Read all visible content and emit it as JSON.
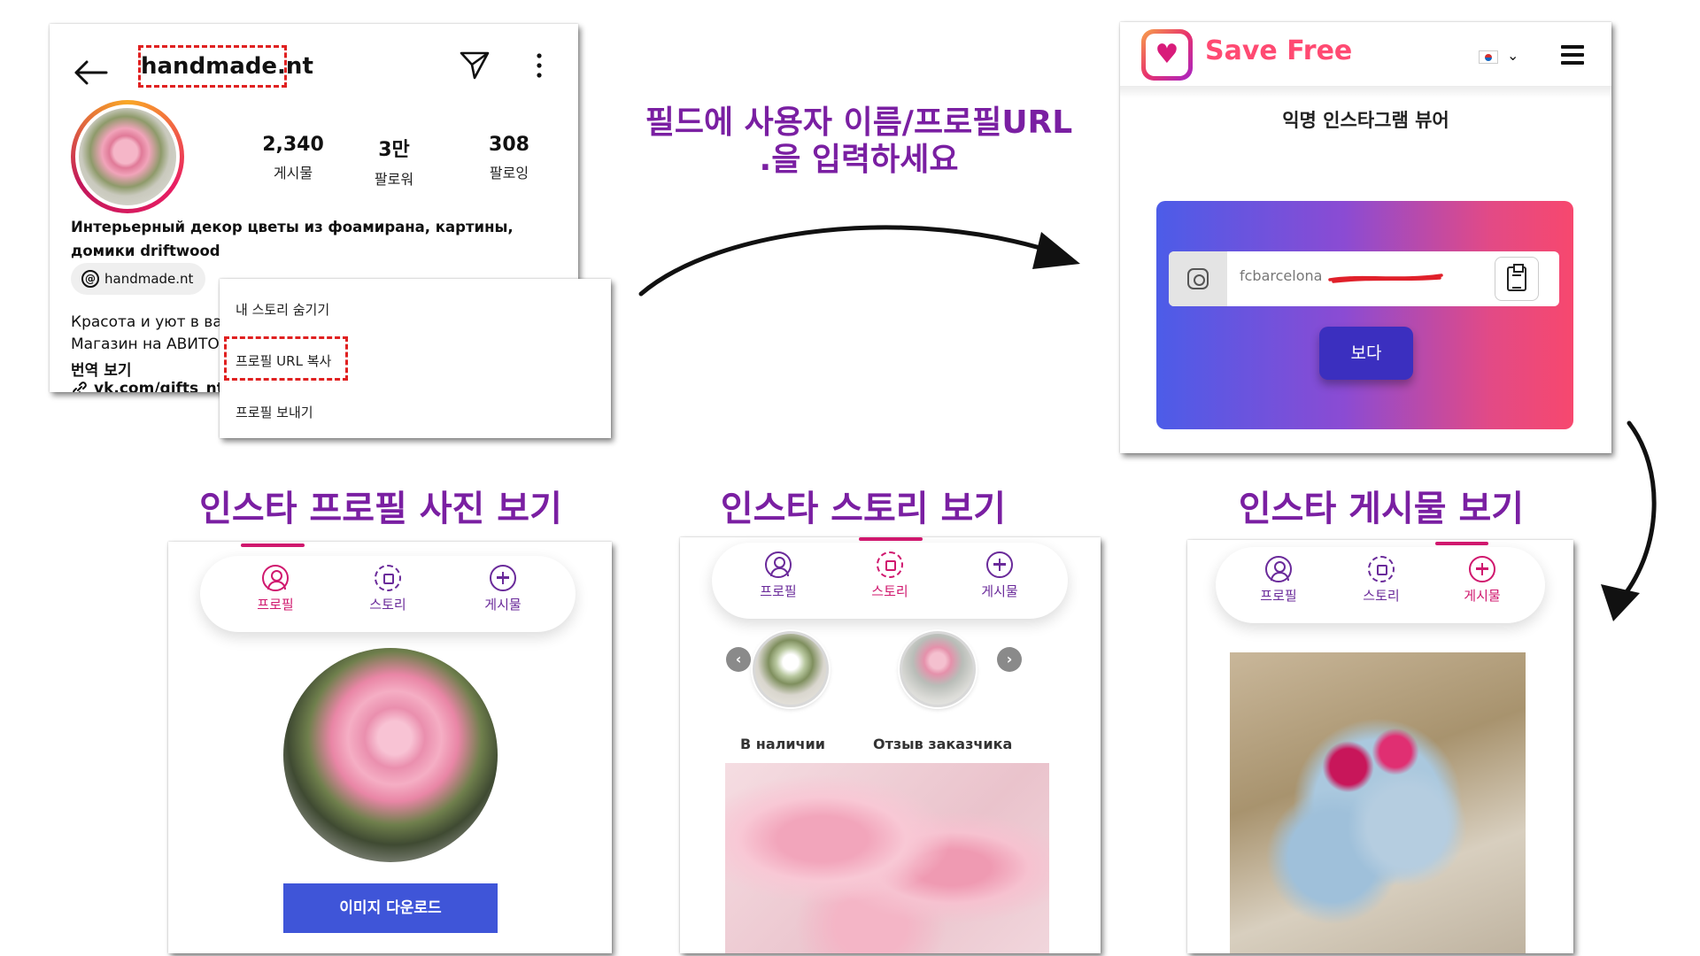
{
  "instagram": {
    "username": "handmade.nt",
    "stats": [
      {
        "value": "2,340",
        "label": "게시물"
      },
      {
        "value": "3만",
        "label": "팔로워"
      },
      {
        "value": "308",
        "label": "팔로잉"
      }
    ],
    "bio": "Интерьерный декор цветы из фоамирана, картины, домики driftwood",
    "threads_handle": "handmade.nt",
    "bio_line1": "Красота  и уют в  ва",
    "bio_line2": "Магазин на АВИТО",
    "translate": "번역 보기",
    "link": "vk.com/gifts_nt_"
  },
  "context_menu": {
    "hide_story": "내 스토리 숨기기",
    "copy_profile_url": "프로필 URL 복사",
    "send_profile": "프로필 보내기"
  },
  "instruction": {
    "line1": "필드에 사용자 이름/프로필URL",
    "line2": ".을 입력하세요"
  },
  "savefree": {
    "brand": "Save Free",
    "subtitle": "익명 인스타그램 뷰어",
    "input_value": "fcbarcelona",
    "view_button": "보다",
    "accent": "#ff4a72"
  },
  "sections": {
    "profile_title": "인스타 프로필 사진 보기",
    "story_title": "인스타 스토리 보기",
    "post_title": "인스타 게시물 보기"
  },
  "tabs": {
    "profile": "프로필",
    "story": "스토리",
    "post": "게시물"
  },
  "profile_view": {
    "download": "이미지 다운로드"
  },
  "story_view": {
    "label1": "В наличии",
    "label2": "Отзыв заказчика"
  },
  "colors": {
    "title_purple": "#7a1fa2",
    "active_pink": "#d0186e",
    "download_blue": "#3f55d8"
  }
}
